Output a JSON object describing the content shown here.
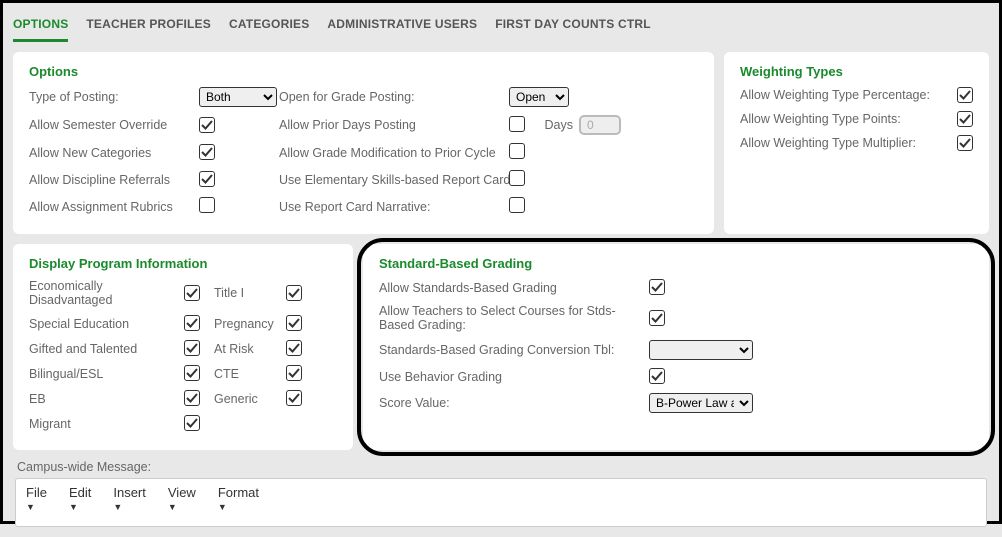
{
  "tabs": {
    "options": "OPTIONS",
    "teacher_profiles": "TEACHER PROFILES",
    "categories": "CATEGORIES",
    "admin_users": "ADMINISTRATIVE USERS",
    "first_day": "FIRST DAY COUNTS CTRL"
  },
  "options_panel": {
    "title": "Options",
    "type_of_posting_label": "Type of Posting:",
    "type_of_posting_value": "Both",
    "open_for_grade_label": "Open for Grade Posting:",
    "open_for_grade_value": "Open",
    "allow_semester_override": "Allow Semester Override",
    "allow_prior_days_posting": "Allow Prior Days Posting",
    "days_label": "Days",
    "days_value": "0",
    "allow_new_categories": "Allow New Categories",
    "allow_grade_mod": "Allow Grade Modification to Prior Cycle",
    "allow_discipline": "Allow Discipline Referrals",
    "use_elementary": "Use Elementary Skills-based Report Card:",
    "allow_rubrics": "Allow Assignment Rubrics",
    "use_report_card": "Use Report Card Narrative:"
  },
  "weighting_panel": {
    "title": "Weighting Types",
    "type_percentage": "Allow Weighting Type Percentage:",
    "type_points": "Allow Weighting Type Points:",
    "type_multiplier": "Allow Weighting Type Multiplier:"
  },
  "dpi_panel": {
    "title": "Display Program Information",
    "econ": "Economically Disadvantaged",
    "special_ed": "Special Education",
    "gifted": "Gifted and Talented",
    "bilingual": "Bilingual/ESL",
    "eb": "EB",
    "migrant": "Migrant",
    "title1": "Title I",
    "pregnancy": "Pregnancy",
    "at_risk": "At Risk",
    "cte": "CTE",
    "generic": "Generic"
  },
  "sbg_panel": {
    "title": "Standard-Based Grading",
    "allow_sbg": "Allow Standards-Based Grading",
    "allow_teachers_select": "Allow Teachers to Select Courses for Stds-Based Grading:",
    "conversion_tbl": "Standards-Based Grading Conversion Tbl:",
    "conversion_tbl_value": "",
    "use_behavior": "Use Behavior Grading",
    "score_value_label": "Score Value:",
    "score_value_value": "B-Power Law and"
  },
  "campus_wide_label": "Campus-wide Message:",
  "editor_menu": {
    "file": "File",
    "edit": "Edit",
    "insert": "Insert",
    "view": "View",
    "format": "Format"
  }
}
